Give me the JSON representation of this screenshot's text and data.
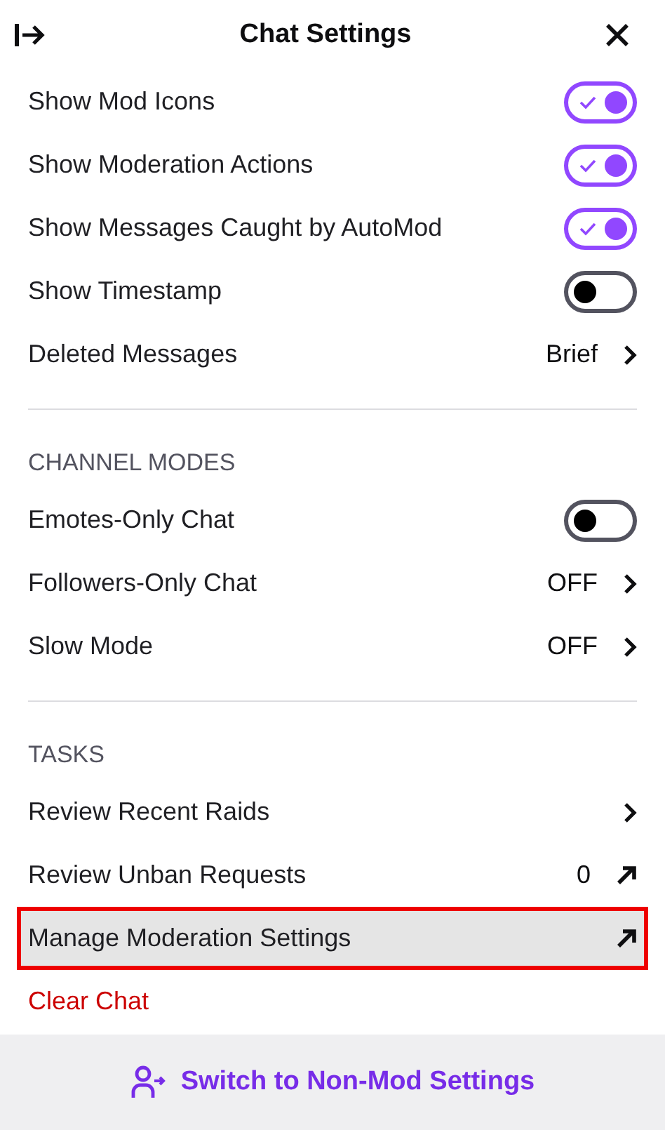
{
  "header": {
    "title": "Chat Settings"
  },
  "sections": [
    {
      "rows": [
        {
          "kind": "toggle",
          "label": "Show Mod Icons",
          "on": true
        },
        {
          "kind": "toggle",
          "label": "Show Moderation Actions",
          "on": true
        },
        {
          "kind": "toggle",
          "label": "Show Messages Caught by AutoMod",
          "on": true
        },
        {
          "kind": "toggle",
          "label": "Show Timestamp",
          "on": false
        },
        {
          "kind": "chevron",
          "label": "Deleted Messages",
          "value": "Brief"
        }
      ]
    },
    {
      "heading": "CHANNEL MODES",
      "rows": [
        {
          "kind": "toggle",
          "label": "Emotes-Only Chat",
          "on": false
        },
        {
          "kind": "chevron",
          "label": "Followers-Only Chat",
          "value": "OFF"
        },
        {
          "kind": "chevron",
          "label": "Slow Mode",
          "value": "OFF"
        }
      ]
    },
    {
      "heading": "TASKS",
      "rows": [
        {
          "kind": "chevron",
          "label": "Review Recent Raids"
        },
        {
          "kind": "external",
          "label": "Review Unban Requests",
          "value": "0",
          "highlighted": false
        },
        {
          "kind": "external",
          "label": "Manage Moderation Settings",
          "highlighted": true
        },
        {
          "kind": "danger",
          "label": "Clear Chat"
        }
      ]
    }
  ],
  "footer": {
    "button": "Switch to Non-Mod Settings"
  }
}
